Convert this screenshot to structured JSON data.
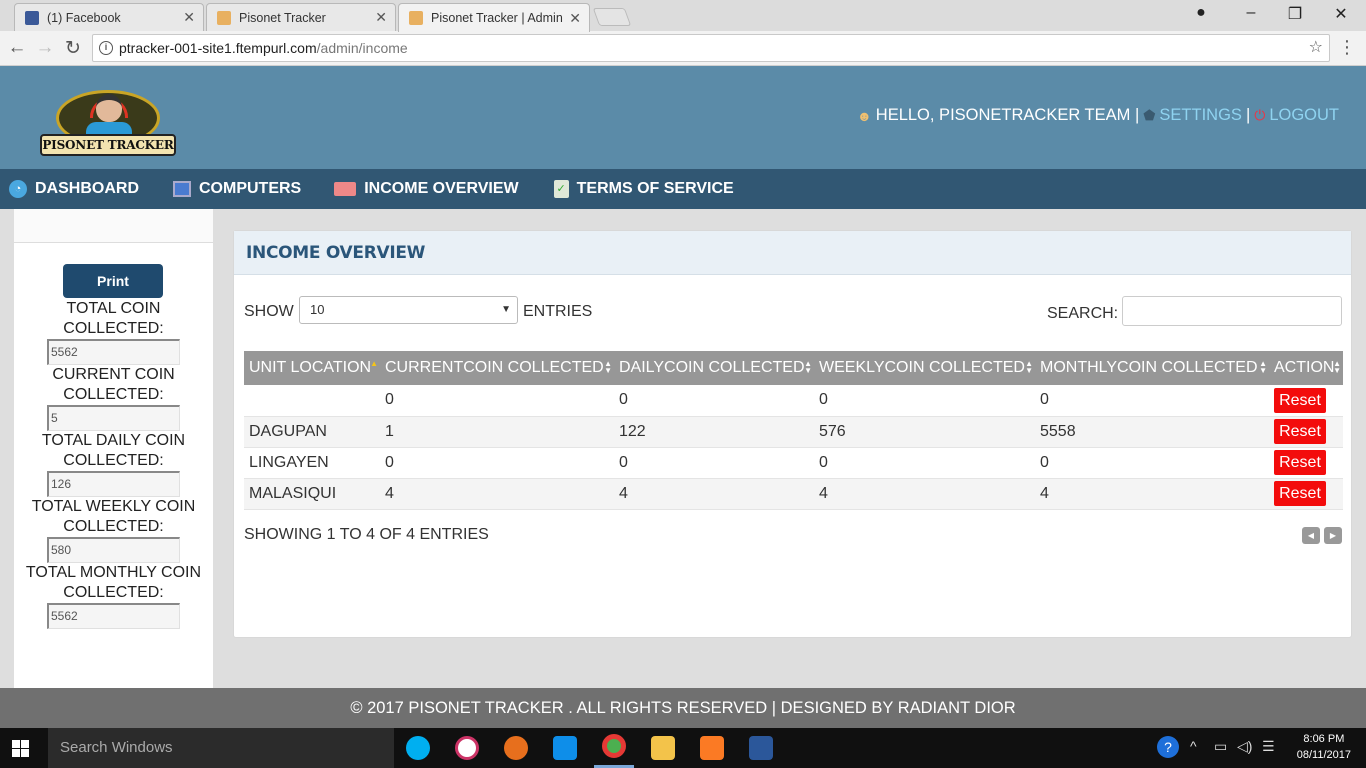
{
  "browser": {
    "tabs": [
      {
        "title": "(1) Facebook",
        "favicon_color": "#3b5998"
      },
      {
        "title": "Pisonet Tracker",
        "favicon_color": "#e8b060"
      },
      {
        "title": "Pisonet Tracker | Admin",
        "favicon_color": "#e8b060"
      }
    ],
    "url_host": "ptracker-001-site1.ftempurl.com",
    "url_path": "/admin/income"
  },
  "header": {
    "logo_text": "PISONET TRACKER",
    "greeting": "HELLO, PISONETRACKER TEAM |",
    "settings": "SETTINGS",
    "separator": "|",
    "logout": "LOGOUT"
  },
  "nav": [
    {
      "label": "DASHBOARD",
      "icon": "dashboard-icon"
    },
    {
      "label": "COMPUTERS",
      "icon": "computer-icon"
    },
    {
      "label": "INCOME OVERVIEW",
      "icon": "money-icon"
    },
    {
      "label": "TERMS OF SERVICE",
      "icon": "clipboard-icon"
    }
  ],
  "sidebar": {
    "print_label": "Print",
    "stats": [
      {
        "label": "TOTAL COIN COLLECTED:",
        "value": "5562"
      },
      {
        "label": "CURRENT COIN COLLECTED:",
        "value": "5"
      },
      {
        "label": "TOTAL DAILY COIN COLLECTED:",
        "value": "126"
      },
      {
        "label": "TOTAL WEEKLY COIN COLLECTED:",
        "value": "580"
      },
      {
        "label": "TOTAL MONTHLY COIN COLLECTED:",
        "value": "5562"
      }
    ]
  },
  "panel": {
    "title": "INCOME OVERVIEW",
    "show_label": "SHOW",
    "show_value": "10",
    "entries_label": "ENTRIES",
    "search_label": "SEARCH:",
    "search_value": "",
    "columns": [
      "UNIT LOCATION",
      "CURRENTCOIN COLLECTED",
      "DAILYCOIN COLLECTED",
      "WEEKLYCOIN COLLECTED",
      "MONTHLYCOIN COLLECTED",
      "ACTION"
    ],
    "rows": [
      {
        "location": "",
        "current": "0",
        "daily": "0",
        "weekly": "0",
        "monthly": "0",
        "action": "Reset"
      },
      {
        "location": "DAGUPAN",
        "current": "1",
        "daily": "122",
        "weekly": "576",
        "monthly": "5558",
        "action": "Reset"
      },
      {
        "location": "LINGAYEN",
        "current": "0",
        "daily": "0",
        "weekly": "0",
        "monthly": "0",
        "action": "Reset"
      },
      {
        "location": "MALASIQUI",
        "current": "4",
        "daily": "4",
        "weekly": "4",
        "monthly": "4",
        "action": "Reset"
      }
    ],
    "showing_text": "SHOWING 1 TO 4 OF 4 ENTRIES"
  },
  "footer": {
    "text": "© 2017 PISONET TRACKER . ALL RIGHTS RESERVED | DESIGNED BY RADIANT DIOR"
  },
  "taskbar": {
    "search_placeholder": "Search Windows",
    "apps": [
      "skype-icon",
      "itunes-icon",
      "firefox-icon",
      "teamviewer-icon",
      "chrome-icon",
      "file-explorer-icon",
      "xampp-icon",
      "word-icon"
    ],
    "time": "8:06 PM",
    "date": "08/11/2017"
  }
}
